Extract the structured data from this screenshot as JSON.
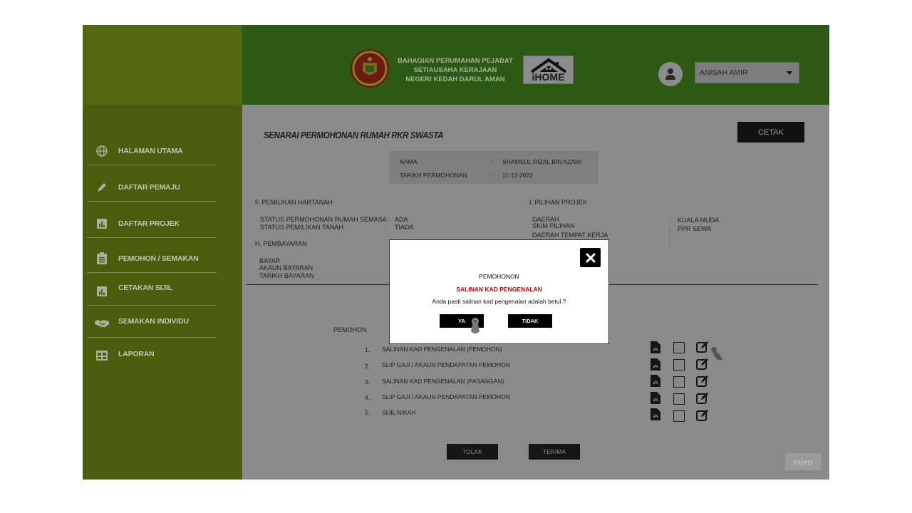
{
  "header": {
    "agency_lines": [
      "BAHAGIAN PERUMAHAN PEJABAT",
      "SETIAUSAHA KERAJAAN",
      "NEGERI KEDAH DARUL AMAN"
    ],
    "app_logo_text": "iHOME",
    "user_name": "ANISAH AMIR"
  },
  "sidebar": {
    "items": [
      {
        "label": "HALAMAN UTAMA",
        "icon": "globe-icon"
      },
      {
        "label": "DAFTAR PEMAJU",
        "icon": "pen-icon"
      },
      {
        "label": "DAFTAR PROJEK",
        "icon": "chart-icon"
      },
      {
        "label": "PEMOHON / SEMAKAN",
        "icon": "clipboard-icon"
      },
      {
        "label": "CETAKAN SIJIL",
        "icon": "chart-icon"
      },
      {
        "label": "SEMAKAN INDIVIDU",
        "icon": "handshake-icon"
      },
      {
        "label": "LAPORAN",
        "icon": "table-icon"
      }
    ]
  },
  "main": {
    "title": "SENARAI PERMOHONAN RUMAH RKR SWASTA",
    "print_label": "CETAK",
    "applicant": {
      "name_label": "NAMA",
      "name_value": "SHAMSUL RIZAL BIN AZAMI",
      "date_label": "TARIKH PERMOHONAN",
      "date_value": "11-12-2022",
      "separator": ":"
    },
    "section_f": {
      "title": "F. PEMILIKAN HARTANAH",
      "row1_label": "STATUS PERMOHONAN RUMAH SEMASA :",
      "row1_value": "ADA",
      "row2_label": "STATUS PEMILIKAN TANAH",
      "row2_sep": ":",
      "row2_value": "TIADA"
    },
    "section_h": {
      "title": "H. PEMBAYARAN",
      "lines": [
        "BAYAR",
        "AKAUN BAYARAN",
        "TARIKH BAYARAN"
      ]
    },
    "section_i": {
      "title": "I. PILIHAN PROJEK",
      "labels": [
        "DAERAH",
        "SKIM PILIHAN",
        "DAERAH TEMPAT KERJA"
      ],
      "values": [
        "KUALA MUDA",
        "PPR SEWA"
      ],
      "separator": ":"
    },
    "documents": {
      "section_label": "PEMOHON",
      "items": [
        {
          "num": "1.",
          "name": "SALINAN KAD PENGENALAN  (PEMOHON)"
        },
        {
          "num": "2.",
          "name": "SLIP GAJI / AKAUN PENDAPATAN PEMOHON"
        },
        {
          "num": "3.",
          "name": "SALINAN KAD PENGENALAN (PASANGAN)"
        },
        {
          "num": "4.",
          "name": "SLIP GAJI / AKAUN PENDAPATAN PEMOHON"
        },
        {
          "num": "5.",
          "name": "SIJIL NIKAH"
        }
      ]
    },
    "reject_label": "TOLAK",
    "accept_label": "TERIMA"
  },
  "modal": {
    "title": "PEMOHONON",
    "subtitle": "SALINAN KAD PENGENALAN",
    "question": "Anda pasti salinan kad pengenalan adalah betul ?",
    "yes_label": "YA",
    "no_label": "TIDAK"
  },
  "watermark": "miro",
  "colors": {
    "sidebar": "#4a5d0f",
    "header": "#2c5a14",
    "overlay_bg": "#8a8a8a",
    "accent_red": "#cc0000"
  }
}
